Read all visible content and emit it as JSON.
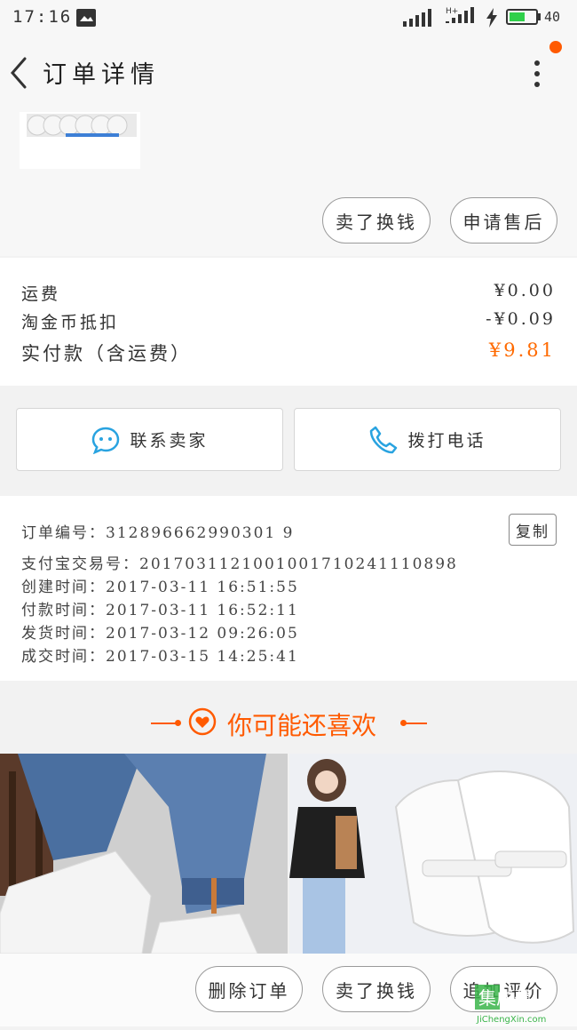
{
  "status_bar": {
    "time": "17:16",
    "battery": "40",
    "network": "H+"
  },
  "header": {
    "title": "订单详情"
  },
  "product_actions": {
    "refund_label": "卖了换钱",
    "aftersale_label": "申请售后"
  },
  "price": {
    "shipping_label": "运费",
    "shipping_value": "¥0.00",
    "coins_label": "淘金币抵扣",
    "coins_value": "-¥0.09",
    "paid_label": "实付款（含运费）",
    "paid_value": "¥9.81"
  },
  "contact": {
    "seller_label": "联系卖家",
    "call_label": "拨打电话"
  },
  "order_info": {
    "order_no": "订单编号：312896662990301 9",
    "alipay_no": "支付宝交易号：2017031121001001710241110898",
    "created": "创建时间：2017-03-11  16:51:55",
    "paid": "付款时间：2017-03-11  16:52:11",
    "shipped": "发货时间：2017-03-12  09:26:05",
    "completed": "成交时间：2017-03-15  14:25:41",
    "copy_label": "复制"
  },
  "recommend": {
    "title": "你可能还喜欢"
  },
  "bottom_actions": {
    "delete_label": "删除订单",
    "sell_label": "卖了换钱",
    "review_label": "追加评价"
  },
  "watermark": {
    "text": "JiChengXin.com",
    "label": "集成馨"
  },
  "colors": {
    "accent": "#ff5a00",
    "price_orange": "#ff6a00",
    "icon_blue": "#29a3e0"
  }
}
